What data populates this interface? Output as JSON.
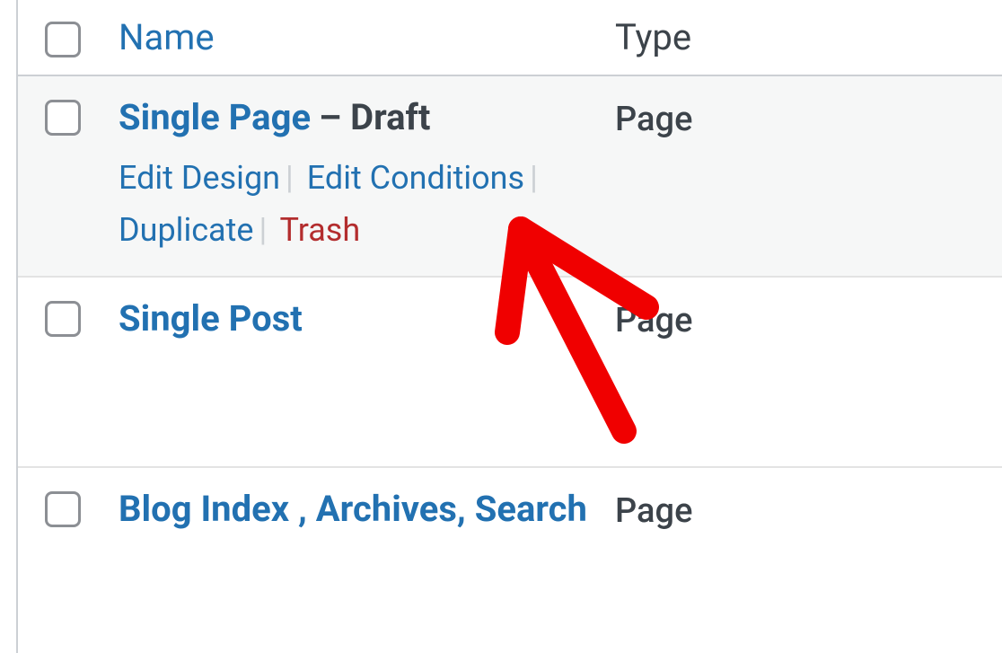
{
  "header": {
    "name_col": "Name",
    "type_col": "Type"
  },
  "rows": [
    {
      "title": "Single Page",
      "status": "Draft",
      "type": "Page",
      "hovered": true,
      "actions": {
        "edit_design": "Edit Design",
        "edit_conditions": "Edit Conditions",
        "duplicate": "Duplicate",
        "trash": "Trash"
      }
    },
    {
      "title": "Single Post",
      "status": "",
      "type": "Page",
      "hovered": false
    },
    {
      "title": "Blog Index , Archives, Search",
      "status": "",
      "type": "Page",
      "hovered": false
    }
  ]
}
